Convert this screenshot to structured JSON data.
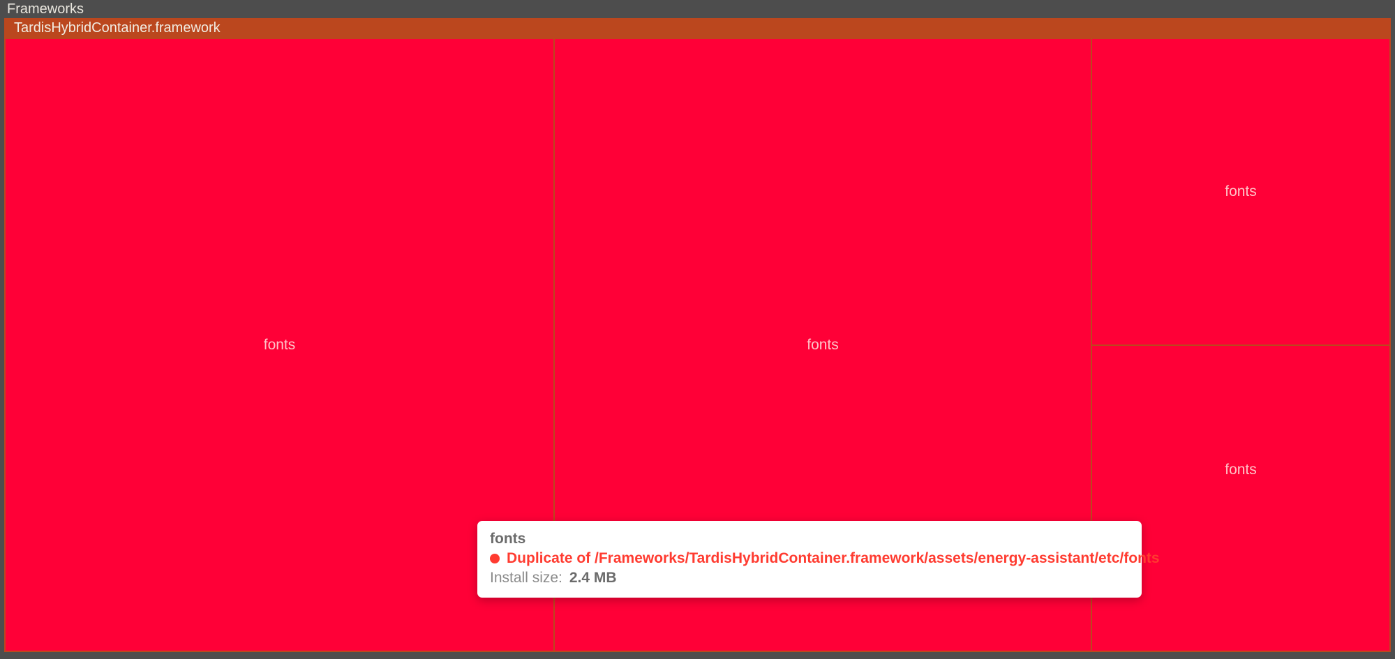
{
  "breadcrumb": {
    "root": "Frameworks",
    "child": "TardisHybridContainer.framework"
  },
  "treemap": {
    "cells": [
      {
        "label": "fonts"
      },
      {
        "label": "fonts"
      },
      {
        "label": "fonts"
      },
      {
        "label": "fonts"
      }
    ]
  },
  "tooltip": {
    "title": "fonts",
    "duplicate_label": "Duplicate of /Frameworks/TardisHybridContainer.framework/assets/energy-assistant/etc/fonts",
    "size_key": "Install size:",
    "size_value": "2.4 MB"
  },
  "colors": {
    "cell": "#ff0037",
    "frame": "#bb471e",
    "bg": "#4d4d4d",
    "dup": "#ff3b30"
  }
}
